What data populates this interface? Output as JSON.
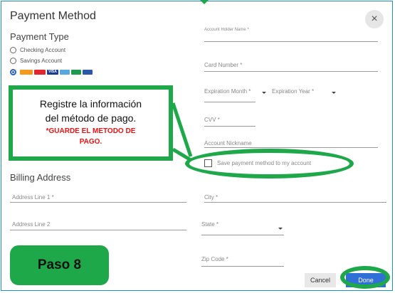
{
  "dialog": {
    "title": "Payment Method",
    "close_icon": "×"
  },
  "payment_type": {
    "title": "Payment Type",
    "options": [
      "Checking Account",
      "Savings Account"
    ],
    "selected": "cards",
    "card_brands": [
      "DISCOVER",
      "MC",
      "VISA",
      "AMEX",
      "JCB",
      "DC"
    ]
  },
  "fields": {
    "account_holder_name": "Account Holder Name *",
    "card_number": "Card Number *",
    "expiration_month": "Expiration Month *",
    "expiration_year": "Expiration Year *",
    "cvv": "CVV *",
    "account_nickname": "Account Nickname",
    "save_label": "Save payment method to my account"
  },
  "billing": {
    "title": "Billing Address",
    "address_line_1": "Address Line 1 *",
    "address_line_2": "Address Line 2",
    "city": "City *",
    "state": "State *",
    "zip": "Zip Code *"
  },
  "callout": {
    "line1": "Registre la información",
    "line2": "del método de pago.",
    "warn1": "*GUARDE EL METODO DE",
    "warn2": "PAGO."
  },
  "step_badge": "Paso 8",
  "buttons": {
    "cancel": "Cancel",
    "done": "Done"
  },
  "colors": {
    "highlight": "#1fa84a",
    "primary": "#2f6fd6",
    "warning": "#e11111"
  }
}
